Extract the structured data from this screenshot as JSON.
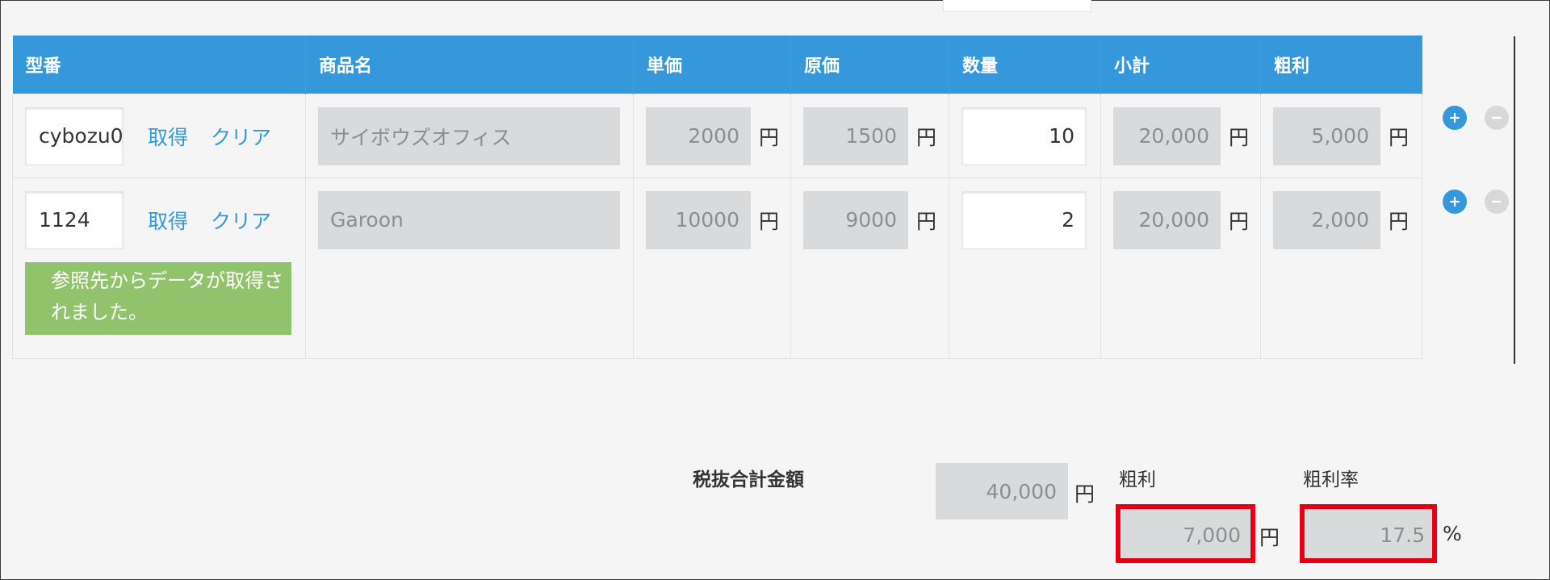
{
  "table": {
    "headers": [
      "型番",
      "商品名",
      "単価",
      "原価",
      "数量",
      "小計",
      "粗利"
    ],
    "get_label": "取得",
    "clear_label": "クリア",
    "unit_yen": "円",
    "rows": [
      {
        "model": "cybozu0",
        "product": "サイボウズオフィス",
        "unit_price": "2000",
        "cost": "1500",
        "quantity": "10",
        "subtotal": "20,000",
        "profit": "5,000"
      },
      {
        "model": "1124",
        "product": "Garoon",
        "unit_price": "10000",
        "cost": "9000",
        "quantity": "2",
        "subtotal": "20,000",
        "profit": "2,000",
        "notice": "参照先からデータが取得されました。"
      }
    ]
  },
  "row_buttons": {
    "add": "plus-icon",
    "remove": "minus-icon",
    "add_color": "#3498db",
    "remove_color": "#d8d8d8"
  },
  "summary": {
    "total_label": "税抜合計金額",
    "total_value": "40,000",
    "profit_label": "粗利",
    "profit_value": "7,000",
    "rate_label": "粗利率",
    "rate_value": "17.5",
    "unit_yen": "円",
    "unit_percent": "%"
  },
  "colors": {
    "header_bg": "#3498db",
    "link": "#3498db",
    "notice_bg": "#91c36c",
    "highlight": "#e60012",
    "readonly_bg": "#d8dadb"
  }
}
